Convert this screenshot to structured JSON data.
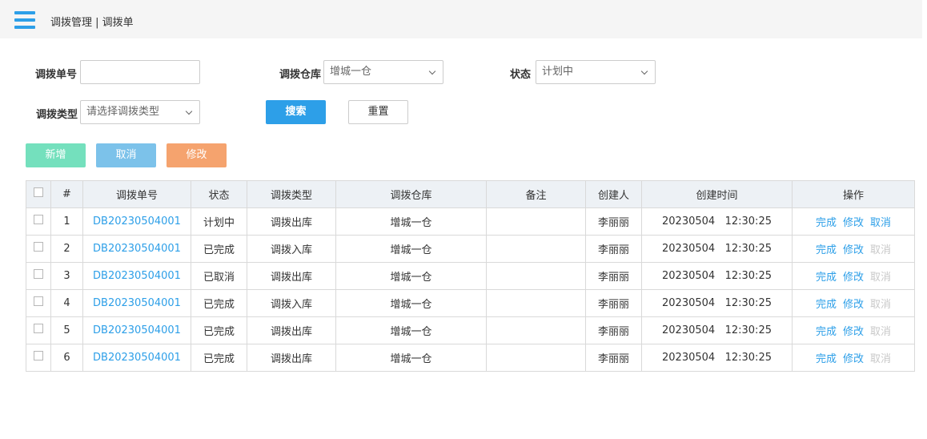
{
  "header": {
    "breadcrumb": "调拨管理 | 调拨单"
  },
  "filters": {
    "order_no_label": "调拨单号",
    "order_no_value": "",
    "warehouse_label": "调拨仓库",
    "warehouse_value": "增城一仓",
    "status_label": "状态",
    "status_value": "计划中",
    "type_label": "调拨类型",
    "type_placeholder": "请选择调拨类型",
    "search_label": "搜索",
    "reset_label": "重置"
  },
  "actions": {
    "add": "新增",
    "cancel": "取消",
    "edit": "修改"
  },
  "colors": {
    "accent": "#2d9fe8",
    "add": "#74e0bd",
    "cancel": "#7cc2ea",
    "edit": "#f5a36e"
  },
  "table": {
    "headers": [
      "#",
      "调拨单号",
      "状态",
      "调拨类型",
      "调拨仓库",
      "备注",
      "创建人",
      "创建时间",
      "操作"
    ],
    "rows": [
      {
        "idx": "1",
        "code": "DB20230504001",
        "status": "计划中",
        "type": "调拨出库",
        "warehouse": "增城一仓",
        "remark": "",
        "creator": "李丽丽",
        "date": "20230504",
        "time": "12:30:25",
        "ops": [
          "完成",
          "修改",
          "取消"
        ],
        "cancel_enabled": true
      },
      {
        "idx": "2",
        "code": "DB20230504001",
        "status": "已完成",
        "type": "调拨入库",
        "warehouse": "增城一仓",
        "remark": "",
        "creator": "李丽丽",
        "date": "20230504",
        "time": "12:30:25",
        "ops": [
          "完成",
          "修改",
          "取消"
        ],
        "cancel_enabled": false
      },
      {
        "idx": "3",
        "code": "DB20230504001",
        "status": "已取消",
        "type": "调拨出库",
        "warehouse": "增城一仓",
        "remark": "",
        "creator": "李丽丽",
        "date": "20230504",
        "time": "12:30:25",
        "ops": [
          "完成",
          "修改",
          "取消"
        ],
        "cancel_enabled": false
      },
      {
        "idx": "4",
        "code": "DB20230504001",
        "status": "已完成",
        "type": "调拨入库",
        "warehouse": "增城一仓",
        "remark": "",
        "creator": "李丽丽",
        "date": "20230504",
        "time": "12:30:25",
        "ops": [
          "完成",
          "修改",
          "取消"
        ],
        "cancel_enabled": false
      },
      {
        "idx": "5",
        "code": "DB20230504001",
        "status": "已完成",
        "type": "调拨出库",
        "warehouse": "增城一仓",
        "remark": "",
        "creator": "李丽丽",
        "date": "20230504",
        "time": "12:30:25",
        "ops": [
          "完成",
          "修改",
          "取消"
        ],
        "cancel_enabled": false
      },
      {
        "idx": "6",
        "code": "DB20230504001",
        "status": "已完成",
        "type": "调拨出库",
        "warehouse": "增城一仓",
        "remark": "",
        "creator": "李丽丽",
        "date": "20230504",
        "time": "12:30:25",
        "ops": [
          "完成",
          "修改",
          "取消"
        ],
        "cancel_enabled": false
      }
    ]
  }
}
